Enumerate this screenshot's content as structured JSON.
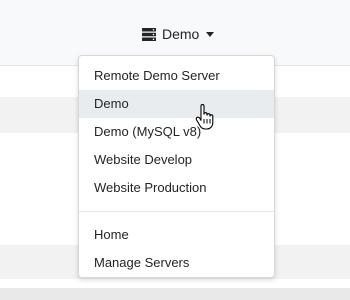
{
  "header": {
    "server_button": {
      "icon": "server-icon",
      "label": "Demo",
      "caret_icon": "caret-down-icon"
    }
  },
  "dropdown": {
    "servers": [
      {
        "label": "Remote Demo Server",
        "active": false
      },
      {
        "label": "Demo",
        "active": true
      },
      {
        "label": "Demo (MySQL v8)",
        "active": false
      },
      {
        "label": "Website Develop",
        "active": false
      },
      {
        "label": "Website Production",
        "active": false
      }
    ],
    "links": [
      {
        "label": "Home"
      },
      {
        "label": "Manage Servers"
      }
    ]
  },
  "cursor": {
    "icon": "hand-pointer-icon"
  },
  "colors": {
    "navbar_bg": "#f8f9fa",
    "active_item_bg": "#e9ecef",
    "text": "#212529"
  }
}
